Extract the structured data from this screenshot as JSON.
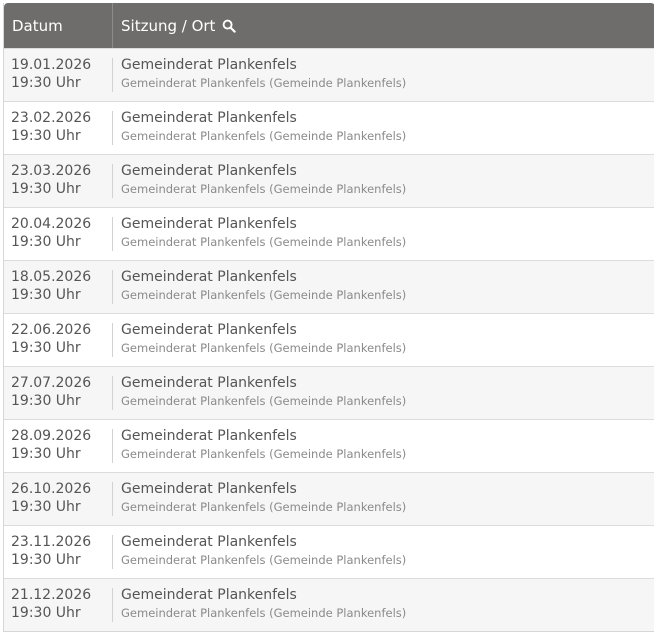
{
  "header": {
    "date_label": "Datum",
    "session_label": "Sitzung / Ort",
    "search_icon": "search-icon"
  },
  "rows": [
    {
      "date": "19.01.2026",
      "time": "19:30 Uhr",
      "title": "Gemeinderat Plankenfels",
      "location": "Gemeinderat Plankenfels (Gemeinde Plankenfels)"
    },
    {
      "date": "23.02.2026",
      "time": "19:30 Uhr",
      "title": "Gemeinderat Plankenfels",
      "location": "Gemeinderat Plankenfels (Gemeinde Plankenfels)"
    },
    {
      "date": "23.03.2026",
      "time": "19:30 Uhr",
      "title": "Gemeinderat Plankenfels",
      "location": "Gemeinderat Plankenfels (Gemeinde Plankenfels)"
    },
    {
      "date": "20.04.2026",
      "time": "19:30 Uhr",
      "title": "Gemeinderat Plankenfels",
      "location": "Gemeinderat Plankenfels (Gemeinde Plankenfels)"
    },
    {
      "date": "18.05.2026",
      "time": "19:30 Uhr",
      "title": "Gemeinderat Plankenfels",
      "location": "Gemeinderat Plankenfels (Gemeinde Plankenfels)"
    },
    {
      "date": "22.06.2026",
      "time": "19:30 Uhr",
      "title": "Gemeinderat Plankenfels",
      "location": "Gemeinderat Plankenfels (Gemeinde Plankenfels)"
    },
    {
      "date": "27.07.2026",
      "time": "19:30 Uhr",
      "title": "Gemeinderat Plankenfels",
      "location": "Gemeinderat Plankenfels (Gemeinde Plankenfels)"
    },
    {
      "date": "28.09.2026",
      "time": "19:30 Uhr",
      "title": "Gemeinderat Plankenfels",
      "location": "Gemeinderat Plankenfels (Gemeinde Plankenfels)"
    },
    {
      "date": "26.10.2026",
      "time": "19:30 Uhr",
      "title": "Gemeinderat Plankenfels",
      "location": "Gemeinderat Plankenfels (Gemeinde Plankenfels)"
    },
    {
      "date": "23.11.2026",
      "time": "19:30 Uhr",
      "title": "Gemeinderat Plankenfels",
      "location": "Gemeinderat Plankenfels (Gemeinde Plankenfels)"
    },
    {
      "date": "21.12.2026",
      "time": "19:30 Uhr",
      "title": "Gemeinderat Plankenfels",
      "location": "Gemeinderat Plankenfels (Gemeinde Plankenfels)"
    }
  ]
}
